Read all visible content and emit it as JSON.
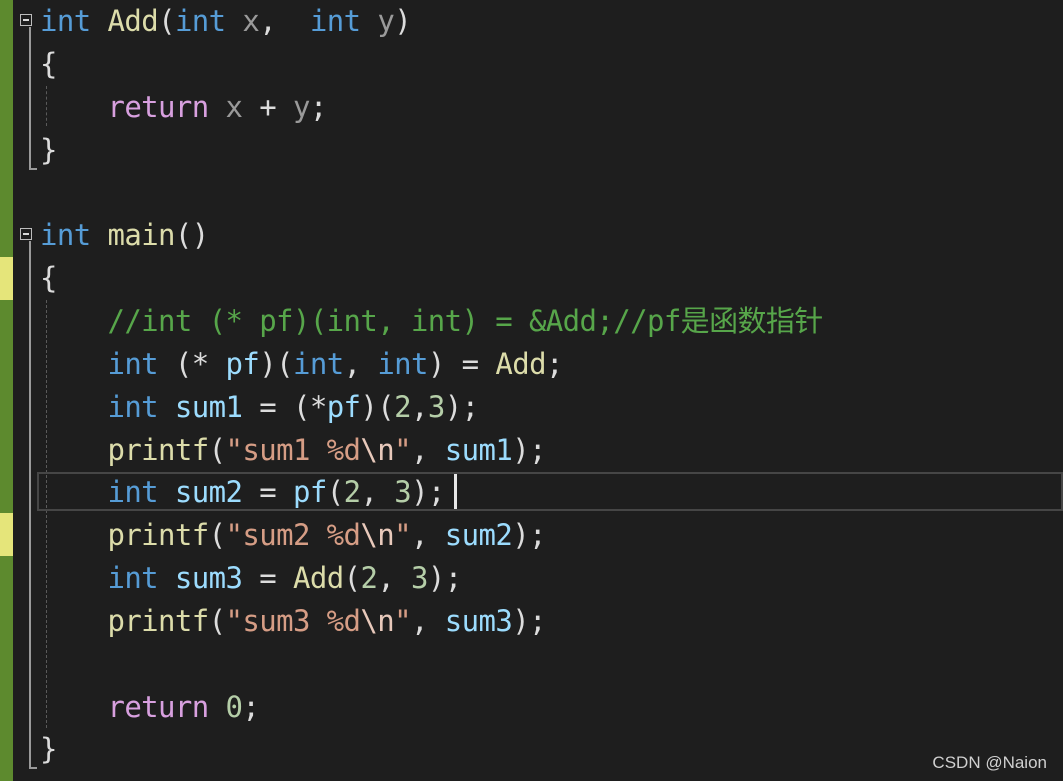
{
  "editor": {
    "language": "C",
    "theme_colors": {
      "background": "#1e1e1e",
      "keyword": "#569cd6",
      "function": "#dcdcaa",
      "parameter": "#9a9a9a",
      "control_flow": "#d8a0df",
      "variable": "#9cdcfe",
      "number": "#b5cea8",
      "string": "#d69d85",
      "comment": "#57a64a",
      "change_saved": "#5d8a2e",
      "change_unsaved": "#e5e57a"
    },
    "lines": {
      "l1": {
        "kw": "int",
        "fn": "Add",
        "open": "(",
        "kw2": "int",
        "p1": "x",
        "comma": ", ",
        "kw3": "int",
        "p2": "y",
        "close": ")"
      },
      "l2": {
        "brace": "{"
      },
      "l3": {
        "ret": "return",
        "p1": "x",
        "op": "+",
        "p2": "y",
        "semi": ";"
      },
      "l4": {
        "brace": "}"
      },
      "l6": {
        "kw": "int",
        "fn": "main",
        "paren": "()"
      },
      "l7": {
        "brace": "{"
      },
      "l8": {
        "comment": "//int (* pf)(int, int) = &Add;//pf是函数指针"
      },
      "l9": {
        "kw": "int",
        "open": "(* ",
        "var": "pf",
        "mid": ")(",
        "kw2": "int",
        "comma": ", ",
        "kw3": "int",
        "close": ")",
        "eq": " = ",
        "fn": "Add",
        "semi": ";"
      },
      "l10": {
        "kw": "int",
        "var": "sum1",
        "eq": " = (*",
        "pf": "pf",
        "open": ")(",
        "n1": "2",
        "comma": ",",
        "n2": "3",
        "close": ");"
      },
      "l11": {
        "fn": "printf",
        "open": "(",
        "str": "\"sum1 %d",
        "esc": "\\n",
        "strend": "\"",
        "comma": ", ",
        "var": "sum1",
        "close": ");"
      },
      "l12": {
        "kw": "int",
        "var": "sum2",
        "eq": " = ",
        "pf": "pf",
        "open": "(",
        "n1": "2",
        "comma": ", ",
        "n2": "3",
        "close": ");"
      },
      "l13": {
        "fn": "printf",
        "open": "(",
        "str": "\"sum2 %d",
        "esc": "\\n",
        "strend": "\"",
        "comma": ", ",
        "var": "sum2",
        "close": ");"
      },
      "l14": {
        "kw": "int",
        "var": "sum3",
        "eq": " = ",
        "fn": "Add",
        "open": "(",
        "n1": "2",
        "comma": ", ",
        "n2": "3",
        "close": ");"
      },
      "l15": {
        "fn": "printf",
        "open": "(",
        "str": "\"sum3 %d",
        "esc": "\\n",
        "strend": "\"",
        "comma": ", ",
        "var": "sum3",
        "close": ");"
      },
      "l17": {
        "ret": "return",
        "n": "0",
        "semi": ";"
      },
      "l18": {
        "brace": "}"
      }
    }
  },
  "watermark": "CSDN @Naion"
}
